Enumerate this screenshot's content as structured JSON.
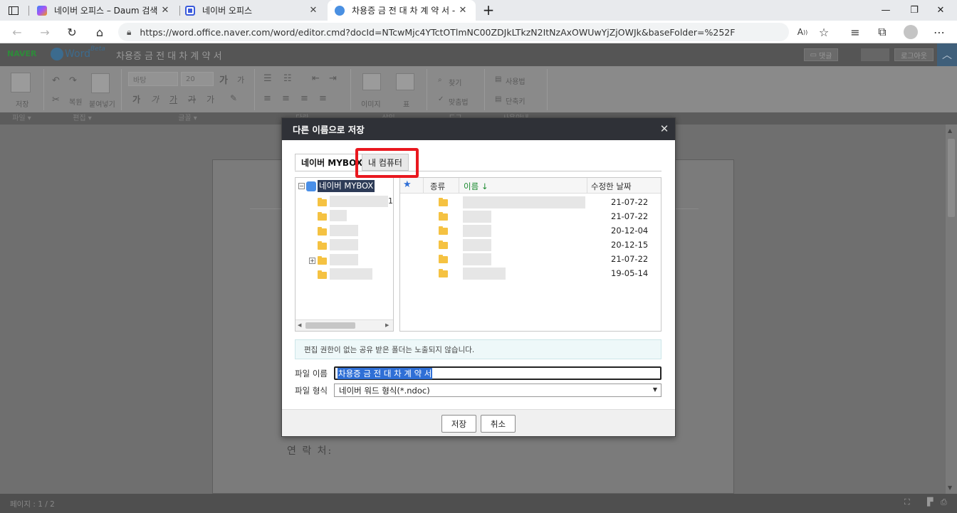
{
  "browser": {
    "tabs": [
      {
        "title": "네이버 오피스 – Daum 검색"
      },
      {
        "title": "네이버 오피스"
      },
      {
        "title": "차용증 금 전 대 차 계 약 서 - 네이"
      }
    ],
    "url": "https://word.office.naver.com/word/editor.cmd?docId=NTcwMjc4YTctOTlmNC00ZDJkLTkzN2ItNzAxOWUwYjZjOWJk&baseFolder=%252F",
    "icons": [
      "sidebar-toggle-icon",
      "back-icon",
      "forward-icon",
      "refresh-icon",
      "home-icon",
      "lock-icon",
      "read-aloud-icon",
      "favorite-add-icon",
      "favorites-icon",
      "collections-icon",
      "profile-icon",
      "more-icon"
    ]
  },
  "app": {
    "brand": "NAVER",
    "product": "Word",
    "product_badge": "Beta",
    "doc_title": "차용증 금 전 대 차 계 약 서",
    "comment_button": "댓글",
    "logout_button": "로그아웃"
  },
  "toolbar": {
    "save_label": "저장",
    "paste_label": "붙여넣기",
    "font_name": "바탕",
    "font_size": "20",
    "grow_font": "가",
    "shrink_font": "가",
    "style_glyphs": [
      "가",
      "가",
      "가",
      "가",
      "가"
    ],
    "image_label": "이미지",
    "table_label": "표",
    "find_label": "찾기",
    "spell_label": "맞춤법",
    "howto_label": "사용법",
    "shortcut_label": "단축키",
    "undo_label": "복원",
    "groups": [
      "파일",
      "편집",
      "글꼴",
      "단락",
      "삽입",
      "도구",
      "사용안내"
    ]
  },
  "document": {
    "contact_line": "연  락  처:"
  },
  "status": {
    "page": "페이지 : 1 / 2"
  },
  "dialog": {
    "title": "다른 이름으로 저장",
    "tabs": [
      "네이버 MYBOX",
      "내 컴퓨터"
    ],
    "tree_root": "네이버 MYBOX",
    "tree_partial_digit": "1",
    "columns": {
      "kind": "종류",
      "name": "이름 ↓",
      "modified": "수정한 날짜"
    },
    "rows": [
      {
        "date": "21-07-22"
      },
      {
        "date": "21-07-22"
      },
      {
        "date": "20-12-04"
      },
      {
        "date": "20-12-15"
      },
      {
        "date": "21-07-22"
      },
      {
        "date": "19-05-14"
      }
    ],
    "notice": "편집 권한이 없는 공유 받은 폴더는 노출되지 않습니다.",
    "file_name_label": "파일 이름",
    "file_name_value": "차용증 금 전 대 차 계 약 서",
    "file_type_label": "파일 형식",
    "file_type_value": "네이버 워드 형식(*.ndoc)",
    "save_button": "저장",
    "cancel_button": "취소"
  },
  "colors": {
    "highlight": "#e9181f",
    "selection": "#2f6fd6",
    "dialog_header": "#2f3137",
    "folder": "#f5c242"
  }
}
